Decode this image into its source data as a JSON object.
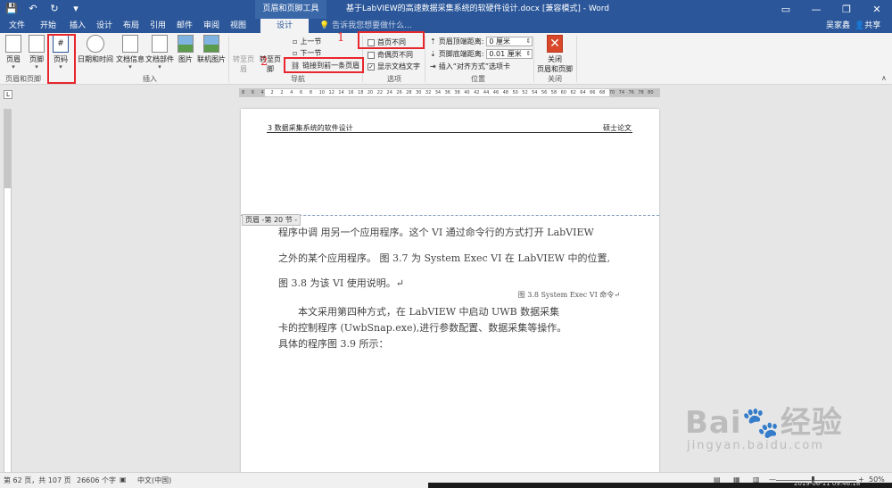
{
  "title_bar": {
    "contextual_group": "页眉和页脚工具",
    "document_title": "基于LabVIEW的高速数据采集系统的软硬件设计.docx [兼容模式] - Word",
    "qat": {
      "save": "💾",
      "undo": "↶",
      "redo": "↻",
      "customize": "▾"
    },
    "window_controls": {
      "ribbon_options": "▭",
      "minimize": "—",
      "restore": "❐",
      "close": "✕"
    }
  },
  "tabs": [
    "文件",
    "开始",
    "插入",
    "设计",
    "布局",
    "引用",
    "邮件",
    "审阅",
    "视图"
  ],
  "contextual_tab": "设计",
  "tell_me": "告诉我您想要做什么...",
  "user": "吴家鑫",
  "share": "共享",
  "ribbon": {
    "group_header_footer": {
      "label": "页眉和页脚",
      "header": "页眉",
      "footer": "页脚",
      "page_number": "页码"
    },
    "group_insert": {
      "label": "插入",
      "date_time": "日期和时间",
      "doc_info": "文档信息",
      "doc_parts": "文档部件",
      "picture": "图片",
      "online_picture": "联机图片"
    },
    "group_navigation": {
      "label": "导航",
      "goto_header": "转至页眉",
      "goto_footer": "转至页脚",
      "previous": "上一节",
      "next": "下一节",
      "link_to_previous": "链接到前一条页眉"
    },
    "group_options": {
      "label": "选项",
      "different_first": "首页不同",
      "different_odd_even": "奇偶页不同",
      "show_doc_text": "显示文档文字"
    },
    "group_position": {
      "label": "位置",
      "header_top_label": "页眉顶端距离:",
      "header_top_value": "0 厘米",
      "footer_bottom_label": "页脚底端距离:",
      "footer_bottom_value": "0.01 厘米",
      "insert_align_tab": "插入“对齐方式”选项卡"
    },
    "group_close": {
      "label": "关闭",
      "close_line1": "关闭",
      "close_line2": "页眉和页脚",
      "close_icon": "✕"
    }
  },
  "annotations": {
    "n1": "1",
    "n2": "2",
    "n3": "3"
  },
  "ruler": {
    "corner": "L",
    "ticks": [
      "8",
      "6",
      "4",
      "2",
      "2",
      "4",
      "6",
      "8",
      "10",
      "12",
      "14",
      "16",
      "18",
      "20",
      "22",
      "24",
      "26",
      "28",
      "30",
      "32",
      "34",
      "36",
      "38",
      "40",
      "42",
      "44",
      "46",
      "48",
      "50",
      "52",
      "54",
      "56",
      "58",
      "60",
      "62",
      "64",
      "66",
      "68",
      "70",
      "74",
      "76",
      "78",
      "80"
    ]
  },
  "page": {
    "header_left": "3 数据采集系统的软件设计",
    "header_right": "硕士论文",
    "header_tag": "页眉 -第 20 节 -",
    "lines": [
      "程序中调 用另一个应用程序。这个 VI 通过命令行的方式打开 LabVIEW",
      "之外的某个应用程序。 图 3.7 为 System Exec VI 在 LabVIEW 中的位置,",
      "图 3.8 为该 VI 使用说明。↵",
      "本文采用第四种方式，在 LabVIEW 中启动 UWB 数据采集",
      "卡的控制程序 (UwbSnap.exe),进行参数配置、数据采集等操作。",
      "具体的程序图 3.9 所示："
    ],
    "caption": "图 3.8 System Exec VI 命令↵"
  },
  "status_bar": {
    "page_info": "第 62 页，共 107 页",
    "word_count": "26606 个字",
    "language": "中文(中国)",
    "zoom": "50%",
    "zoom_minus": "—",
    "zoom_plus": "+"
  },
  "taskbar": {
    "datetime": "2019-06-11 09:46:18"
  },
  "watermark": {
    "logo": "Bai🐾经验",
    "url": "jingyan.baidu.com"
  },
  "colors": {
    "brand": "#2b579a",
    "annotation_red": "#e8262d"
  }
}
